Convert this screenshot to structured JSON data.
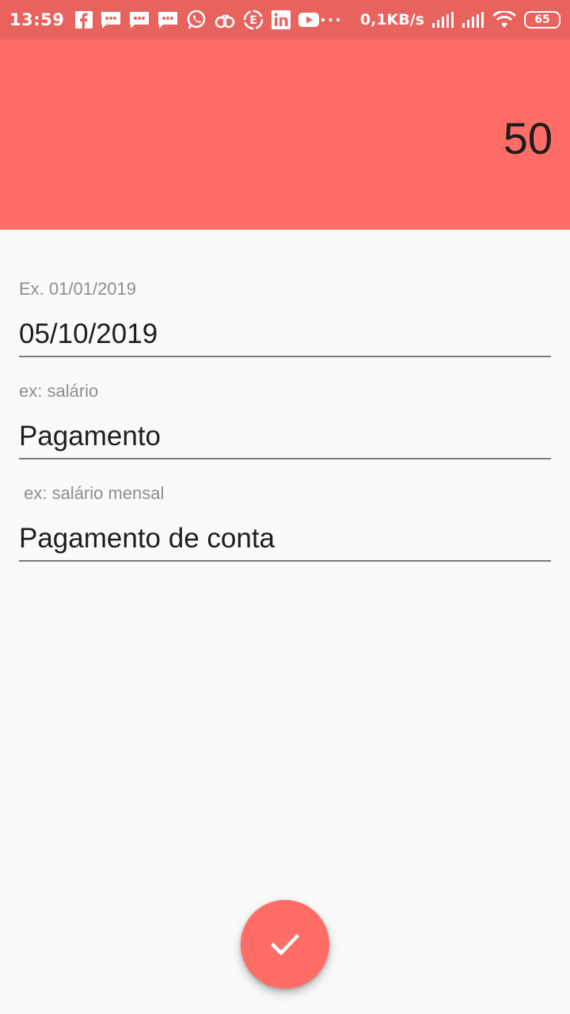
{
  "status_bar": {
    "time": "13:59",
    "speed": "0,1KB/s",
    "battery": "65",
    "more_dots": "···",
    "notification_icons": [
      "facebook-icon",
      "message-icon",
      "message-icon",
      "message-icon",
      "whatsapp-icon",
      "cloud-icon",
      "e-icon",
      "linkedin-icon",
      "youtube-icon"
    ]
  },
  "header": {
    "amount": "50",
    "background_color": "#ff6d66"
  },
  "form": {
    "date": {
      "placeholder": "Ex. 01/01/2019",
      "value": "05/10/2019"
    },
    "category": {
      "placeholder": "ex: salário",
      "value": "Pagamento"
    },
    "description": {
      "placeholder": " ex: salário mensal",
      "value": "Pagamento de conta"
    }
  },
  "fab": {
    "icon": "check-icon",
    "color": "#ff6d66"
  }
}
